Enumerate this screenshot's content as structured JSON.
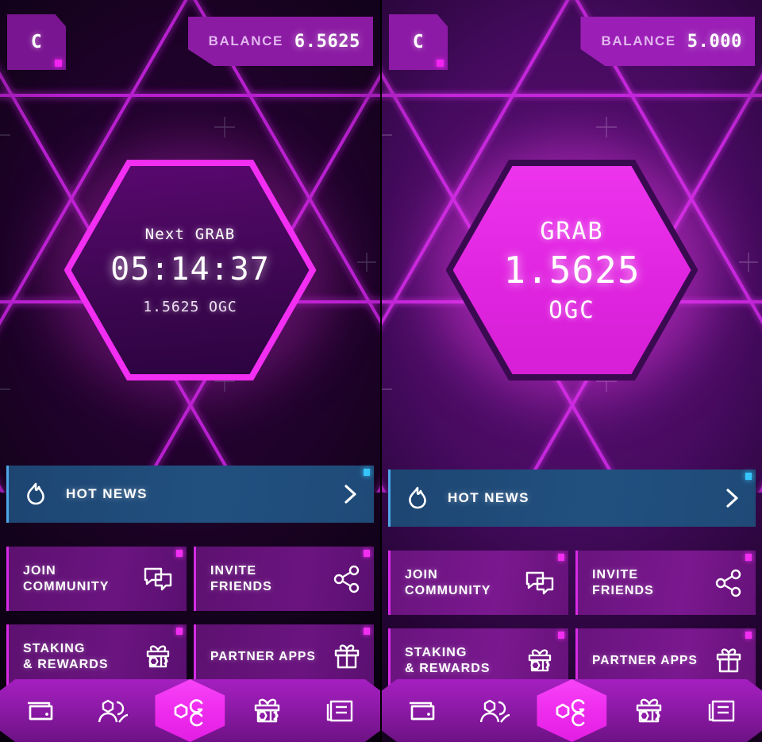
{
  "app": {
    "brand_letter": "C",
    "accent_magenta": "#f22ef2",
    "accent_purple": "#7a1591",
    "accent_blue": "#37c6fb",
    "bg_dark": "#10001a",
    "bg_bright": "#430a5c"
  },
  "panels": [
    {
      "state": "cooldown",
      "header": {
        "logo_letter": "C",
        "balance_label": "BALANCE",
        "balance_value": "6.5625"
      },
      "hero": {
        "label": "Next GRAB",
        "value": "05:14:37",
        "sub": "1.5625 OGC",
        "style": "outline"
      },
      "news": {
        "title": "HOT NEWS",
        "icon": "flame-icon",
        "chevron": "chevron-right-icon"
      },
      "cards": [
        {
          "label": "JOIN\nCOMMUNITY",
          "icon": "chat-bubbles-icon"
        },
        {
          "label": "INVITE\nFRIENDS",
          "icon": "share-nodes-icon"
        },
        {
          "label": "STAKING\n& REWARDS",
          "icon": "gift-hex-icon"
        },
        {
          "label": "PARTNER APPS",
          "icon": "gift-icon"
        }
      ],
      "nav": [
        {
          "name": "wallet",
          "icon": "wallet-icon",
          "active": false
        },
        {
          "name": "friends",
          "icon": "people-icon",
          "active": false
        },
        {
          "name": "ogc",
          "icon": "ogc-logo-icon",
          "active": true
        },
        {
          "name": "rewards",
          "icon": "gift-hex-icon",
          "active": false
        },
        {
          "name": "news",
          "icon": "news-icon",
          "active": false
        }
      ]
    },
    {
      "state": "ready",
      "header": {
        "logo_letter": "C",
        "balance_label": "BALANCE",
        "balance_value": "5.000"
      },
      "hero": {
        "label": "GRAB",
        "value": "1.5625",
        "sub": "OGC",
        "style": "filled"
      },
      "news": {
        "title": "HOT NEWS",
        "icon": "flame-icon",
        "chevron": "chevron-right-icon"
      },
      "cards": [
        {
          "label": "JOIN\nCOMMUNITY",
          "icon": "chat-bubbles-icon"
        },
        {
          "label": "INVITE\nFRIENDS",
          "icon": "share-nodes-icon"
        },
        {
          "label": "STAKING\n& REWARDS",
          "icon": "gift-hex-icon"
        },
        {
          "label": "PARTNER APPS",
          "icon": "gift-icon"
        }
      ],
      "nav": [
        {
          "name": "wallet",
          "icon": "wallet-icon",
          "active": false
        },
        {
          "name": "friends",
          "icon": "people-icon",
          "active": false
        },
        {
          "name": "ogc",
          "icon": "ogc-logo-icon",
          "active": true
        },
        {
          "name": "rewards",
          "icon": "gift-hex-icon",
          "active": false
        },
        {
          "name": "news",
          "icon": "news-icon",
          "active": false
        }
      ]
    }
  ]
}
